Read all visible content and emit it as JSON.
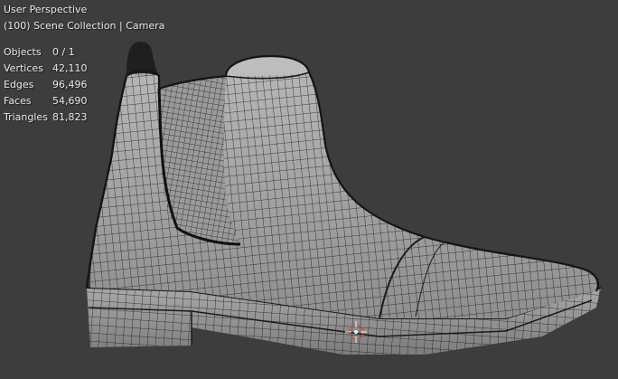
{
  "viewport": {
    "perspective_label": "User Perspective",
    "collection_label": "(100) Scene Collection | Camera",
    "background_color": "#3d3d3d",
    "mesh_fill_color": "#a3a3a3",
    "wire_color": "#1c1c1c",
    "origin_color": "#d84a3c"
  },
  "stats": [
    {
      "label": "Objects",
      "value": "0 / 1"
    },
    {
      "label": "Vertices",
      "value": "42,110"
    },
    {
      "label": "Edges",
      "value": "96,496"
    },
    {
      "label": "Faces",
      "value": "54,690"
    },
    {
      "label": "Triangles",
      "value": "81,823"
    }
  ],
  "icons": {
    "origin": "object-origin-cursor-icon",
    "mesh": "boot-mesh-icon"
  }
}
